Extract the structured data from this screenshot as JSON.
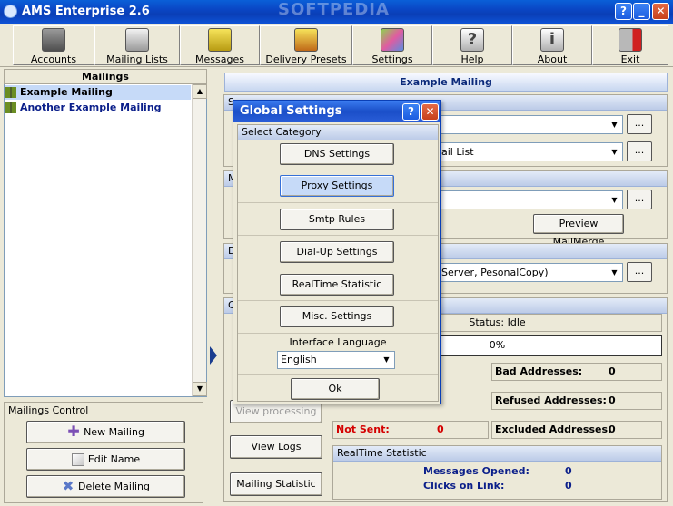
{
  "window": {
    "title": "AMS Enterprise 2.6",
    "help_btn": "?",
    "minimize_btn": "_",
    "close_btn": "✕"
  },
  "watermark": "SOFTPEDIA",
  "toolbar": {
    "items": [
      {
        "label": "Accounts",
        "icon": "accounts-icon"
      },
      {
        "label": "Mailing Lists",
        "icon": "mailing-lists-icon"
      },
      {
        "label": "Messages",
        "icon": "messages-icon"
      },
      {
        "label": "Delivery Presets",
        "icon": "delivery-presets-icon"
      },
      {
        "label": "Settings",
        "icon": "settings-icon"
      },
      {
        "label": "Help",
        "icon": "help-icon"
      },
      {
        "label": "About",
        "icon": "about-icon"
      },
      {
        "label": "Exit",
        "icon": "exit-icon"
      }
    ]
  },
  "mailings": {
    "header": "Mailings",
    "items": [
      "Example Mailing",
      "Another Example Mailing"
    ]
  },
  "mailings_control": {
    "header": "Mailings Control",
    "new": "New Mailing",
    "edit": "Edit Name",
    "delete": "Delete Mailing"
  },
  "right": {
    "title": "Example Mailing",
    "account_combo": "",
    "list_combo": "ail List",
    "message_combo": "",
    "preview_btn": "Preview MailMerge",
    "delivery_combo": "Server, PesonalCopy)",
    "ellipsis": "...",
    "status": "Status: Idle",
    "progress": "0%",
    "view_processing": "View processing",
    "view_logs": "View Logs",
    "mailing_statistic": "Mailing Statistic",
    "bad_addresses_label": "Bad Addresses:",
    "bad_addresses": "0",
    "refused_label": "Refused Addresses:",
    "refused": "0",
    "not_sent_label": "Not Sent:",
    "not_sent": "0",
    "excluded_label": "Excluded Addresses:",
    "excluded": "0",
    "realtime_header": "RealTime Statistic",
    "opened_label": "Messages Opened:",
    "opened": "0",
    "clicks_label": "Clicks on Link:",
    "clicks": "0",
    "group1_partial": "S",
    "group2_partial": "M",
    "group3_partial": "D",
    "group4_partial": "C"
  },
  "dialog": {
    "title": "Global Settings",
    "help_btn": "?",
    "close_btn": "✕",
    "category_header": "Select Category",
    "buttons": [
      "DNS Settings",
      "Proxy Settings",
      "Smtp Rules",
      "Dial-Up Settings",
      "RealTime Statistic",
      "Misc. Settings"
    ],
    "language_label": "Interface Language",
    "language_value": "English",
    "ok": "Ok"
  }
}
